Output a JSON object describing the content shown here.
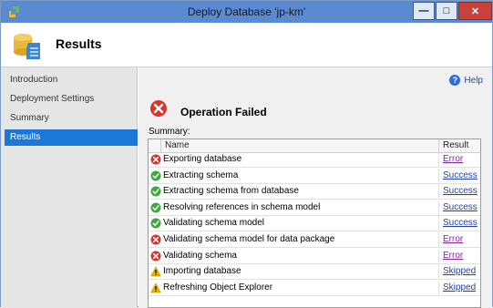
{
  "window": {
    "title": "Deploy Database 'jp-km'",
    "controls": {
      "minimize": "—",
      "maximize": "□",
      "close": "✕"
    }
  },
  "header": {
    "title": "Results"
  },
  "sidebar": {
    "items": [
      {
        "label": "Introduction",
        "active": false
      },
      {
        "label": "Deployment Settings",
        "active": false
      },
      {
        "label": "Summary",
        "active": false
      },
      {
        "label": "Results",
        "active": true
      }
    ]
  },
  "main": {
    "help_label": "Help",
    "status_text": "Operation Failed",
    "summary_label": "Summary:",
    "columns": {
      "name": "Name",
      "result": "Result"
    },
    "rows": [
      {
        "name": "Exporting database",
        "result": "Error",
        "status": "error"
      },
      {
        "name": "Extracting schema",
        "result": "Success",
        "status": "success"
      },
      {
        "name": "Extracting schema from database",
        "result": "Success",
        "status": "success"
      },
      {
        "name": "Resolving references in schema model",
        "result": "Success",
        "status": "success"
      },
      {
        "name": "Validating schema model",
        "result": "Success",
        "status": "success"
      },
      {
        "name": "Validating schema model for data package",
        "result": "Error",
        "status": "error"
      },
      {
        "name": "Validating schema",
        "result": "Error",
        "status": "error"
      },
      {
        "name": "Importing database",
        "result": "Skipped",
        "status": "warning"
      },
      {
        "name": "Refreshing Object Explorer",
        "result": "Skipped",
        "status": "warning"
      }
    ]
  },
  "colors": {
    "titlebar": "#5a8bd2",
    "sidebar_active": "#1c78d8",
    "error": "#d9342b",
    "success": "#3fa83f",
    "warning": "#e8b400",
    "link": "#1f3fb5"
  }
}
